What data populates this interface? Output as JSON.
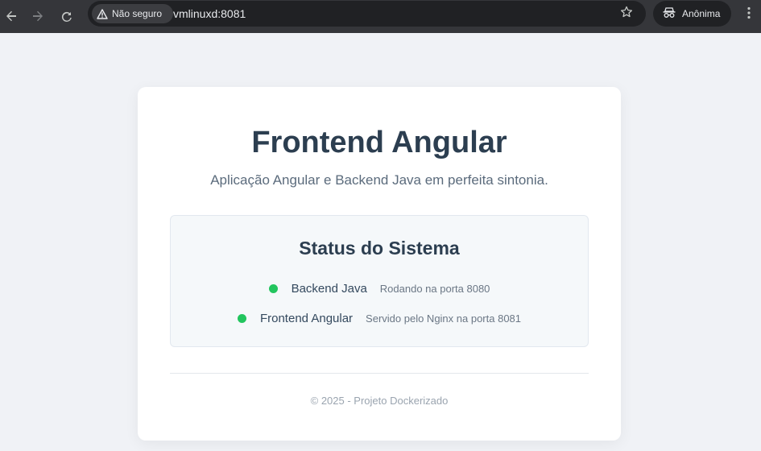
{
  "browser": {
    "security_label": "Não seguro",
    "url": "vmlinuxd:8081",
    "profile_label": "Anônima",
    "icons": {
      "back": "arrow-left-icon",
      "forward": "arrow-right-icon",
      "reload": "reload-icon",
      "warning": "warning-triangle-icon",
      "bookmark": "star-icon",
      "incognito": "incognito-icon",
      "menu": "kebab-menu-icon"
    }
  },
  "page": {
    "title": "Frontend Angular",
    "subtitle": "Aplicação Angular e Backend Java em perfeita sintonia.",
    "status": {
      "heading": "Status do Sistema",
      "items": [
        {
          "name": "Backend Java",
          "detail": "Rodando na porta 8080",
          "state_color": "#22c55e"
        },
        {
          "name": "Frontend Angular",
          "detail": "Servido pelo Nginx na porta 8081",
          "state_color": "#22c55e"
        }
      ]
    },
    "footer": "© 2025 - Projeto Dockerizado"
  },
  "colors": {
    "chrome_bg": "#35363a",
    "page_bg": "#f0f2f6",
    "card_bg": "#ffffff",
    "title": "#2c3e50",
    "status_ok": "#22c55e"
  }
}
